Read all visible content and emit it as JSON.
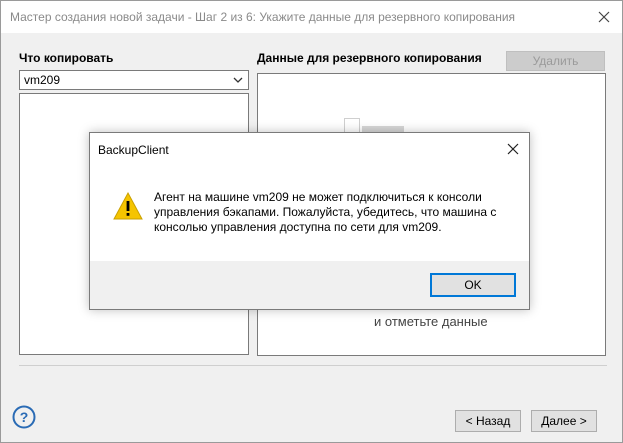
{
  "wizard": {
    "title": "Мастер создания новой задачи - Шаг 2 из 6: Укажите данные для резервного копирования",
    "what_to_copy_label": "Что копировать",
    "source_value": "vm209",
    "backup_data_label": "Данные для резервного копирования",
    "delete_label": "Удалить",
    "hint_text": "и отметьте данные",
    "back_label": "< Назад",
    "next_label": "Далее >",
    "icons": {
      "close": "close-icon",
      "help": "help-icon",
      "dropdown": "chevron-down-icon"
    }
  },
  "dialog": {
    "title": "BackupClient",
    "message": "Агент на машине vm209 не может подключиться к консоли управления бэкапами. Пожалуйста, убедитесь, что машина с консолью управления доступна по сети для vm209.",
    "ok_label": "OK",
    "icon": "warning-icon"
  },
  "colors": {
    "accent": "#0078d7",
    "warning": "#f5c400",
    "help": "#2a6bb5"
  }
}
